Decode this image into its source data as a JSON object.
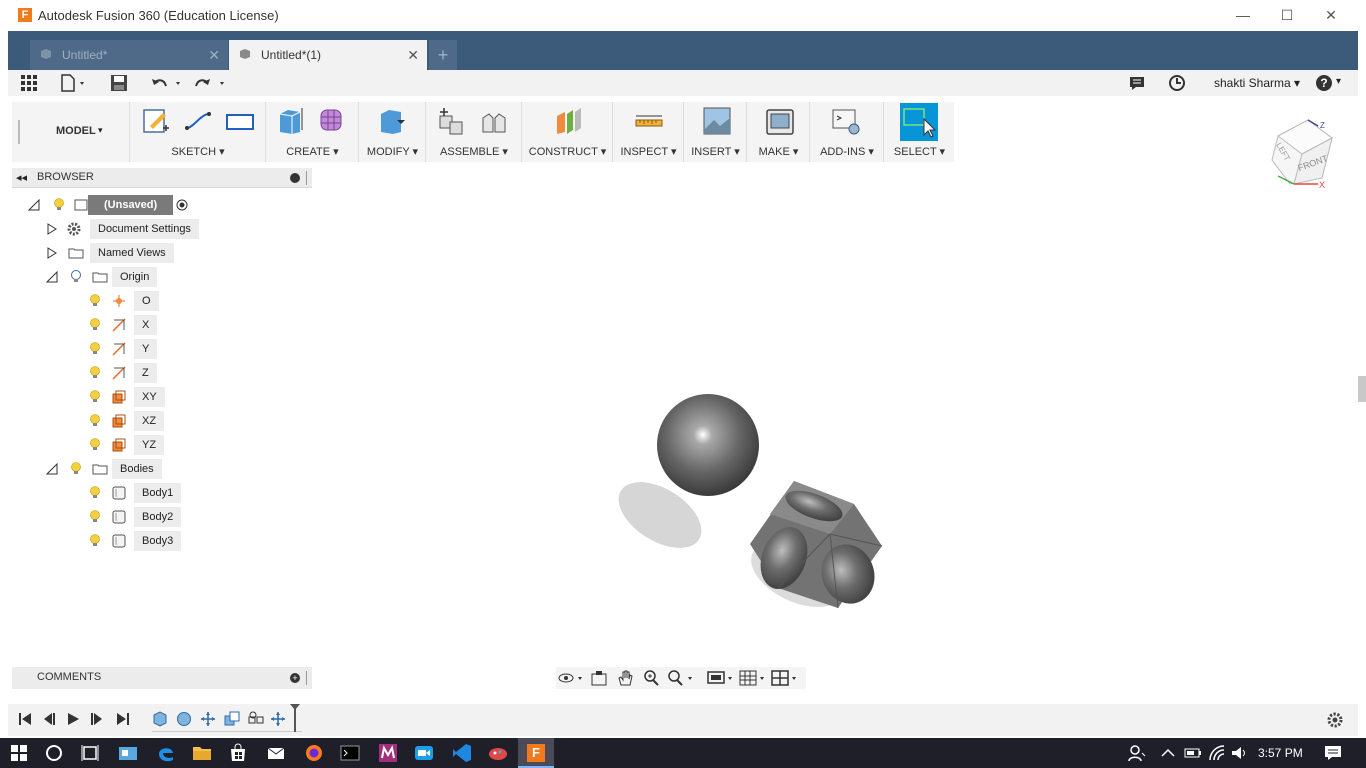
{
  "window": {
    "title": "Autodesk Fusion 360 (Education License)",
    "minimize": "—",
    "maximize": "☐",
    "close": "✕"
  },
  "tabs": [
    {
      "label": "Untitled*",
      "close": "✕",
      "active": false
    },
    {
      "label": "Untitled*(1)",
      "close": "✕",
      "active": true
    }
  ],
  "new_tab": "+",
  "quick_access": {
    "user": "shakti Sharma",
    "help": "?"
  },
  "ribbon": {
    "workspace": "MODEL",
    "groups": [
      "SKETCH",
      "CREATE",
      "MODIFY",
      "ASSEMBLE",
      "CONSTRUCT",
      "INSPECT",
      "INSERT",
      "MAKE",
      "ADD-INS",
      "SELECT"
    ]
  },
  "browser": {
    "title": "BROWSER",
    "root": "(Unsaved)",
    "items": {
      "document_settings": "Document Settings",
      "named_views": "Named Views",
      "origin": "Origin",
      "o": "O",
      "x": "X",
      "y": "Y",
      "z": "Z",
      "xy": "XY",
      "xz": "XZ",
      "yz": "YZ",
      "bodies": "Bodies",
      "body1": "Body1",
      "body2": "Body2",
      "body3": "Body3"
    }
  },
  "viewcube": {
    "left": "LEFT",
    "front": "FRONT",
    "z": "Z",
    "x": "X"
  },
  "comments": {
    "title": "COMMENTS"
  },
  "taskbar": {
    "time": "3:57 PM"
  },
  "colors": {
    "accent": "#0696d7",
    "tabbar": "#3c5a7a",
    "origin_plane": "#f08a3c",
    "bulb": "#f3d03e"
  }
}
